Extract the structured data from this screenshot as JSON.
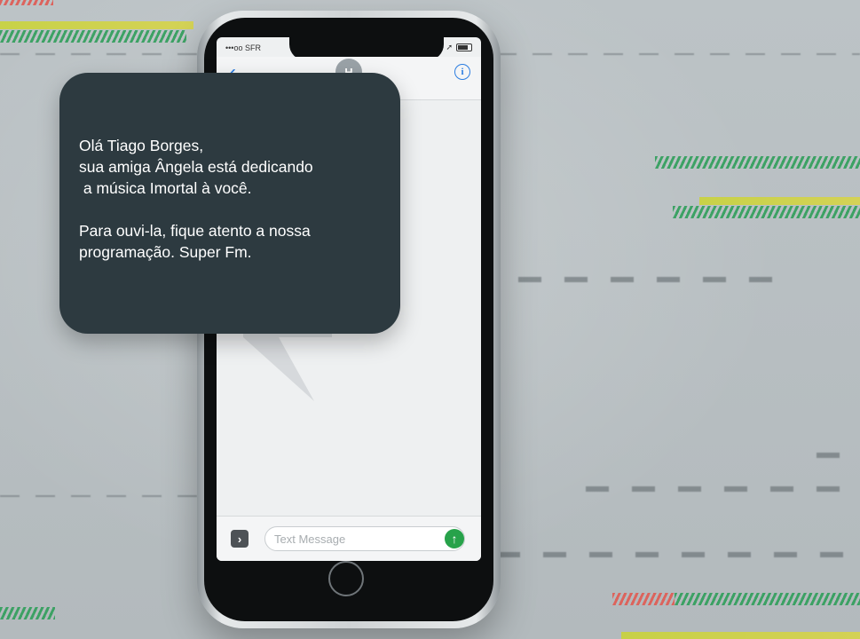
{
  "status_bar": {
    "carrier": "•••oo SFR",
    "wifi_icon": "wifi-icon"
  },
  "contact": {
    "initial": "H"
  },
  "nav": {
    "back_glyph": "‹",
    "info_glyph": "i"
  },
  "compose": {
    "placeholder": "Text Message",
    "apps_glyph": "›",
    "send_glyph": "↑"
  },
  "card": {
    "line1": "Olá Tiago Borges,",
    "line2": "sua amiga Ângela está dedicando",
    "line3": " a música Imortal à você.",
    "line4": "Para ouvi-la, fique atento a nossa",
    "line5": "programação. Super Fm."
  },
  "colors": {
    "card_bg": "#2d3a40",
    "accent_blue": "#2b7de1",
    "send_green": "#27a24a",
    "glitch_green": "#2f9e5a",
    "glitch_yellow": "#c9d33a",
    "glitch_red": "#e05a52"
  }
}
